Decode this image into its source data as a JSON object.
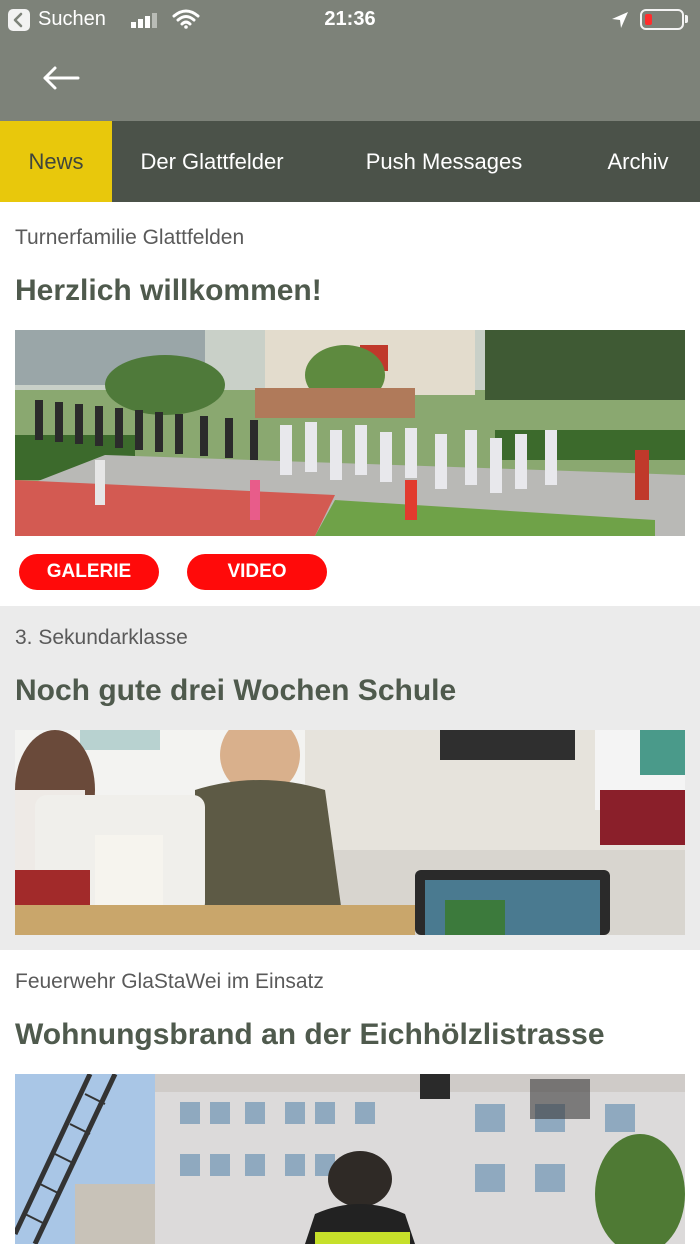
{
  "status_bar": {
    "back_app_label": "Suchen",
    "time": "21:36",
    "battery_color": "#ff2d2d"
  },
  "nav": {
    "back_icon": "arrow-left-icon"
  },
  "tabs": [
    {
      "label": "News",
      "active": true
    },
    {
      "label": "Der Glattfelder",
      "active": false
    },
    {
      "label": "Push Messages",
      "active": false
    },
    {
      "label": "Archiv",
      "active": false
    }
  ],
  "colors": {
    "header": "#7d8279",
    "tabbar": "#4b5249",
    "active_tab": "#e8c80c",
    "title": "#4f5a4d",
    "pill": "#ff0a0a"
  },
  "articles": [
    {
      "category": "Turnerfamilie Glattfelden",
      "title": "Herzlich willkommen!",
      "buttons": [
        "GALERIE",
        "VIDEO"
      ]
    },
    {
      "category": "3. Sekundarklasse",
      "title": "Noch gute drei Wochen Schule"
    },
    {
      "category": "Feuerwehr GlaStaWei im Einsatz",
      "title": "Wohnungsbrand an der Eichhölzlistrasse"
    }
  ]
}
